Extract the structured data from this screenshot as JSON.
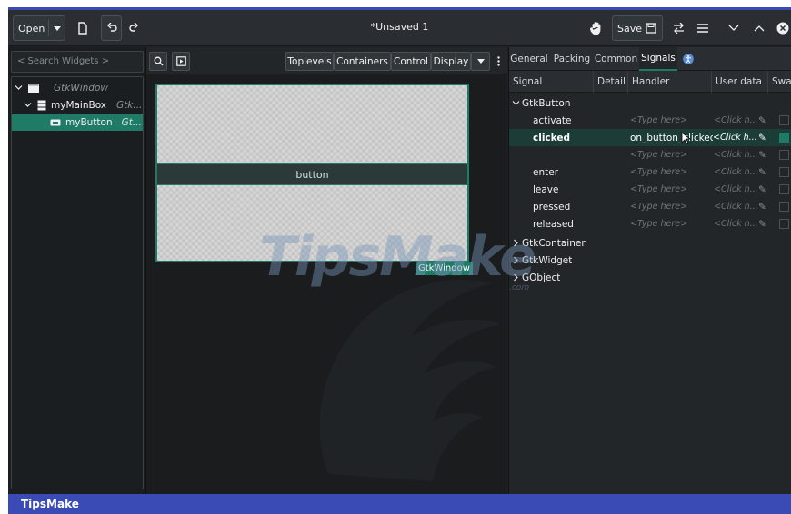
{
  "header": {
    "open_label": "Open",
    "title": "*Unsaved 1",
    "save_label": "Save"
  },
  "widgets": {
    "search_placeholder": "< Search Widgets >",
    "tree": [
      {
        "name": "GtkWindow",
        "type": ""
      },
      {
        "name": "myMainBox",
        "type": "Gtk..."
      },
      {
        "name": "myButton",
        "type": "Gt..."
      }
    ]
  },
  "palette": {
    "categories": [
      "Toplevels",
      "Containers",
      "Control",
      "Display"
    ]
  },
  "canvas": {
    "button_label": "button",
    "window_label": "GtkWindow"
  },
  "inspector": {
    "tabs": [
      "General",
      "Packing",
      "Common",
      "Signals"
    ],
    "active_tab": "Signals",
    "columns": [
      "Signal",
      "Detail",
      "Handler",
      "User data",
      "Swa"
    ],
    "groups": [
      {
        "name": "GtkButton",
        "expanded": true,
        "signals": [
          {
            "name": "activate",
            "handler": "<Type here>",
            "user_data": "<Click h...",
            "bold": false
          },
          {
            "name": "clicked",
            "handler": "on_button_clicked",
            "user_data": "<Click h...",
            "bold": true
          },
          {
            "name": "",
            "handler": "<Type here>",
            "user_data": "<Click h...",
            "bold": false
          },
          {
            "name": "enter",
            "handler": "<Type here>",
            "user_data": "<Click h...",
            "bold": false
          },
          {
            "name": "leave",
            "handler": "<Type here>",
            "user_data": "<Click h...",
            "bold": false
          },
          {
            "name": "pressed",
            "handler": "<Type here>",
            "user_data": "<Click h...",
            "bold": false
          },
          {
            "name": "released",
            "handler": "<Type here>",
            "user_data": "<Click h...",
            "bold": false
          }
        ]
      },
      {
        "name": "GtkContainer",
        "expanded": false
      },
      {
        "name": "GtkWidget",
        "expanded": false
      },
      {
        "name": "GObject",
        "expanded": false
      }
    ]
  },
  "watermark": {
    "text": "TipsMake",
    "small": ".com"
  },
  "footer": {
    "text": "TipsMake"
  },
  "colors": {
    "accent": "#1f7a66",
    "footer": "#3b4bb5",
    "background": "#202326"
  }
}
